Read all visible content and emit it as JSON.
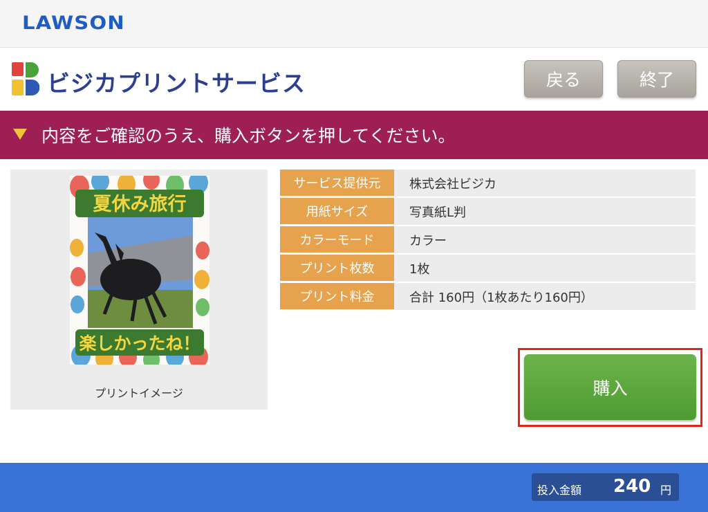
{
  "topbar": {
    "store_logo": "LAWSON"
  },
  "header": {
    "service_title": "ビジカプリントサービス",
    "back_label": "戻る",
    "exit_label": "終了"
  },
  "banner": {
    "instruction": "内容をご確認のうえ、購入ボタンを押してください。"
  },
  "preview": {
    "caption": "プリントイメージ",
    "image_title": "夏休み旅行",
    "image_bottom_text": "楽しかったね！"
  },
  "details": [
    {
      "label": "サービス提供元",
      "value": "株式会社ビジカ"
    },
    {
      "label": "用紙サイズ",
      "value": "写真紙L判"
    },
    {
      "label": "カラーモード",
      "value": "カラー"
    },
    {
      "label": "プリント枚数",
      "value": "1枚"
    },
    {
      "label": "プリント料金",
      "value": "合計 160円（1枚あたり160円）"
    }
  ],
  "purchase": {
    "label": "購入"
  },
  "footer": {
    "amount_label": "投入金額",
    "amount_value": "240",
    "amount_unit": "円"
  },
  "colors": {
    "brand_blue": "#1f5cc4",
    "banner": "#9e1f55",
    "table_key": "#e6a24c",
    "buy_button": "#5aa63d",
    "highlight": "#e1251b",
    "footer": "#3a73d6"
  }
}
